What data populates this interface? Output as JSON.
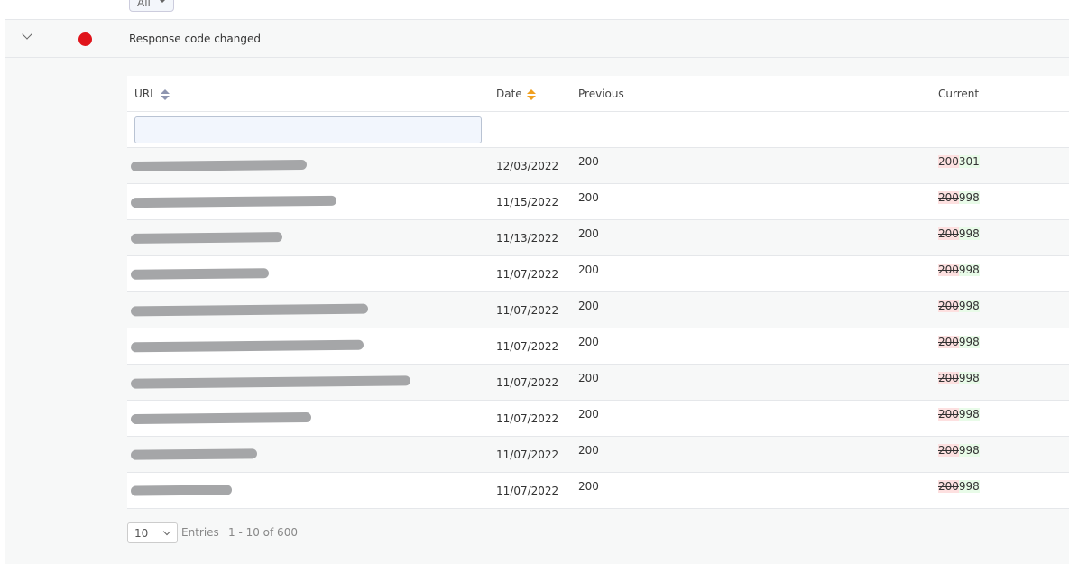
{
  "top_filter": {
    "value": "All"
  },
  "group": {
    "title": "Response code changed",
    "status_color": "#e0141b"
  },
  "table": {
    "columns": [
      {
        "label": "URL",
        "sort": "none"
      },
      {
        "label": "Date",
        "sort": "active"
      },
      {
        "label": "Previous"
      },
      {
        "label": "Current"
      }
    ],
    "filter_placeholder": "",
    "rows": [
      {
        "date": "12/03/2022",
        "previous": "200",
        "current_old": "200",
        "current_new": "301"
      },
      {
        "date": "11/15/2022",
        "previous": "200",
        "current_old": "200",
        "current_new": "998"
      },
      {
        "date": "11/13/2022",
        "previous": "200",
        "current_old": "200",
        "current_new": "998"
      },
      {
        "date": "11/07/2022",
        "previous": "200",
        "current_old": "200",
        "current_new": "998"
      },
      {
        "date": "11/07/2022",
        "previous": "200",
        "current_old": "200",
        "current_new": "998"
      },
      {
        "date": "11/07/2022",
        "previous": "200",
        "current_old": "200",
        "current_new": "998"
      },
      {
        "date": "11/07/2022",
        "previous": "200",
        "current_old": "200",
        "current_new": "998"
      },
      {
        "date": "11/07/2022",
        "previous": "200",
        "current_old": "200",
        "current_new": "998"
      },
      {
        "date": "11/07/2022",
        "previous": "200",
        "current_old": "200",
        "current_new": "998"
      },
      {
        "date": "11/07/2022",
        "previous": "200",
        "current_old": "200",
        "current_new": "998"
      }
    ]
  },
  "footer": {
    "page_size": "10",
    "entries_label": "Entries",
    "range": "1 - 10 of 600"
  }
}
